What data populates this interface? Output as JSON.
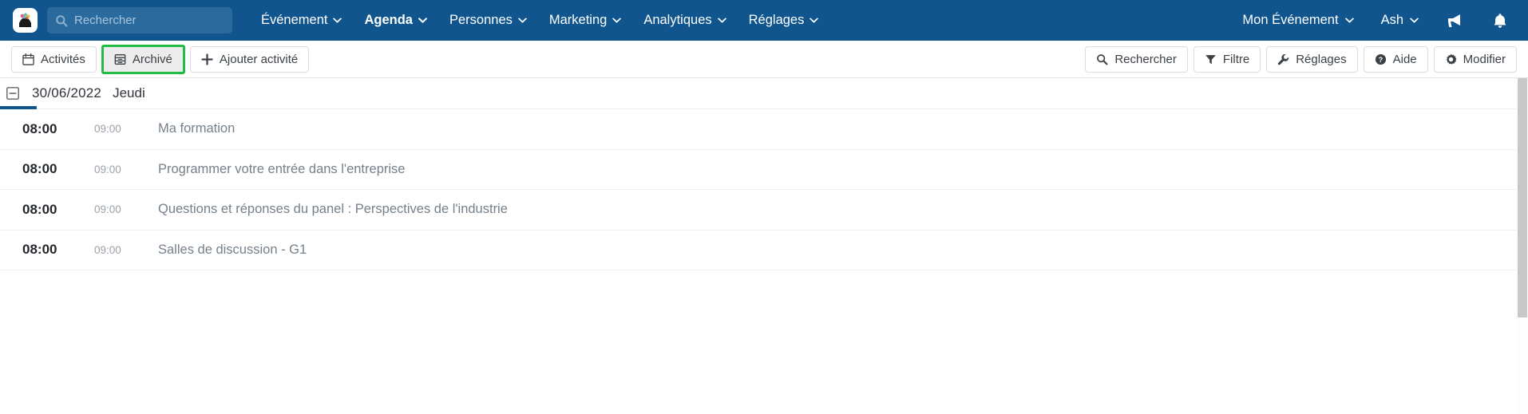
{
  "topbar": {
    "logo_alt": "app-logo",
    "search": {
      "placeholder": "Rechercher",
      "value": "",
      "icon": "search-icon"
    },
    "nav_items": [
      {
        "label": "Événement",
        "active": false,
        "caret": "chevron-down-icon"
      },
      {
        "label": "Agenda",
        "active": true,
        "caret": "chevron-down-icon"
      },
      {
        "label": "Personnes",
        "active": false,
        "caret": "chevron-down-icon"
      },
      {
        "label": "Marketing",
        "active": false,
        "caret": "chevron-down-icon"
      },
      {
        "label": "Analytiques",
        "active": false,
        "caret": "chevron-down-icon"
      },
      {
        "label": "Réglages",
        "active": false,
        "caret": "chevron-down-icon"
      }
    ],
    "right_items": [
      {
        "label": "Mon Événement",
        "caret": "chevron-down-icon"
      },
      {
        "label": "Ash",
        "caret": "chevron-down-icon"
      }
    ],
    "icons": [
      {
        "name": "megaphone-icon"
      },
      {
        "name": "bell-icon"
      }
    ],
    "colors": {
      "bar_background": "#10558d",
      "search_background": "#2a6a9d",
      "text": "#ffffff"
    }
  },
  "toolbar": {
    "left_buttons": [
      {
        "label": "Activités",
        "icon": "calendar-icon",
        "highlighted": false
      },
      {
        "label": "Archivé",
        "icon": "archive-icon",
        "highlighted": true
      },
      {
        "label": "Ajouter activité",
        "icon": "plus-icon",
        "highlighted": false
      }
    ],
    "right_buttons": [
      {
        "label": "Rechercher",
        "icon": "search-icon"
      },
      {
        "label": "Filtre",
        "icon": "filter-icon"
      },
      {
        "label": "Réglages",
        "icon": "wrench-icon"
      },
      {
        "label": "Aide",
        "icon": "help-circle-icon"
      },
      {
        "label": "Modifier",
        "icon": "gear-icon"
      }
    ],
    "highlight_color": "#22bb44"
  },
  "agenda": {
    "date_header": {
      "collapse_icon": "minus-square-icon",
      "date": "30/06/2022",
      "weekday": "Jeudi",
      "accent_color": "#10558d"
    },
    "columns": [
      "start_time",
      "end_time",
      "title"
    ],
    "rows": [
      {
        "start_time": "08:00",
        "end_time": "09:00",
        "title": "Ma formation"
      },
      {
        "start_time": "08:00",
        "end_time": "09:00",
        "title": "Programmer votre entrée dans l'entreprise"
      },
      {
        "start_time": "08:00",
        "end_time": "09:00",
        "title": "Questions et réponses du panel : Perspectives de l'industrie"
      },
      {
        "start_time": "08:00",
        "end_time": "09:00",
        "title": "Salles de discussion - G1"
      }
    ]
  }
}
